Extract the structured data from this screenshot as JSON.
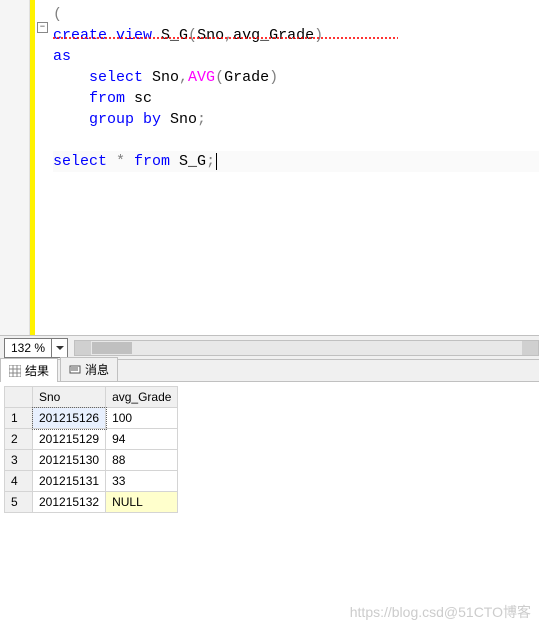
{
  "editor": {
    "lines": {
      "prefix_open": "(",
      "l1_create": "create",
      "l1_view": " view",
      "l1_sg": " S_G",
      "l1_open": "(",
      "l1_sno": "Sno",
      "l1_comma": ",",
      "l1_avg_grade": "avg_Grade",
      "l1_close": ")",
      "l2_as": "as",
      "l3_select": "    select",
      "l3_sno": " Sno",
      "l3_comma": ",",
      "l3_avg": "AVG",
      "l3_open": "(",
      "l3_grade": "Grade",
      "l3_close": ")",
      "l4_from": "    from",
      "l4_sc": " sc",
      "l5_group": "    group",
      "l5_by": " by",
      "l5_sno": " Sno",
      "l5_semi": ";",
      "l7_select": "select",
      "l7_star": " *",
      "l7_from": " from",
      "l7_sg": " S_G",
      "l7_semi": ";"
    },
    "fold_icon": "−"
  },
  "zoom": {
    "value": "132 %"
  },
  "tabs": {
    "results_label": "结果",
    "messages_label": "消息"
  },
  "chart_data": {
    "type": "table",
    "columns": [
      "Sno",
      "avg_Grade"
    ],
    "rows": [
      {
        "Sno": "201215126",
        "avg_Grade": "100"
      },
      {
        "Sno": "201215129",
        "avg_Grade": "94"
      },
      {
        "Sno": "201215130",
        "avg_Grade": "88"
      },
      {
        "Sno": "201215131",
        "avg_Grade": "33"
      },
      {
        "Sno": "201215132",
        "avg_Grade": "NULL"
      }
    ],
    "row_numbers": [
      "1",
      "2",
      "3",
      "4",
      "5"
    ]
  },
  "watermark": "https://blog.csd@51CTO博客"
}
